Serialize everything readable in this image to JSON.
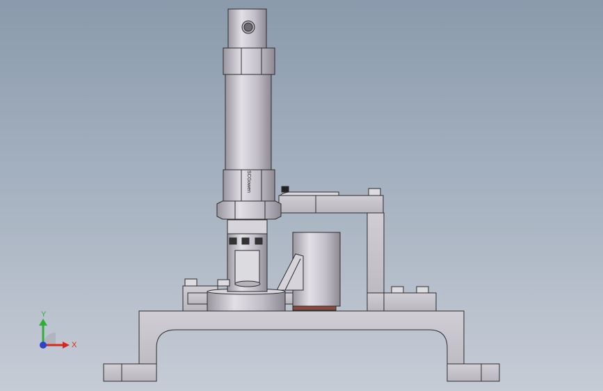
{
  "viewport": {
    "background_top": "#8a9aac",
    "background_bottom": "#c6ccd6"
  },
  "model": {
    "part_color": "#c9c6cc",
    "edge_color": "#2b2b2b",
    "highlight_color": "#e6e4ea",
    "shadow_color": "#8f8b93",
    "gasket_color": "#8a4a3c",
    "cylinder_logo": "SCGowen"
  },
  "triad": {
    "x_label": "X",
    "y_label": "Y",
    "x_color": "#d42a1e",
    "y_color": "#2fae3a",
    "z_color": "#2b43c8"
  }
}
